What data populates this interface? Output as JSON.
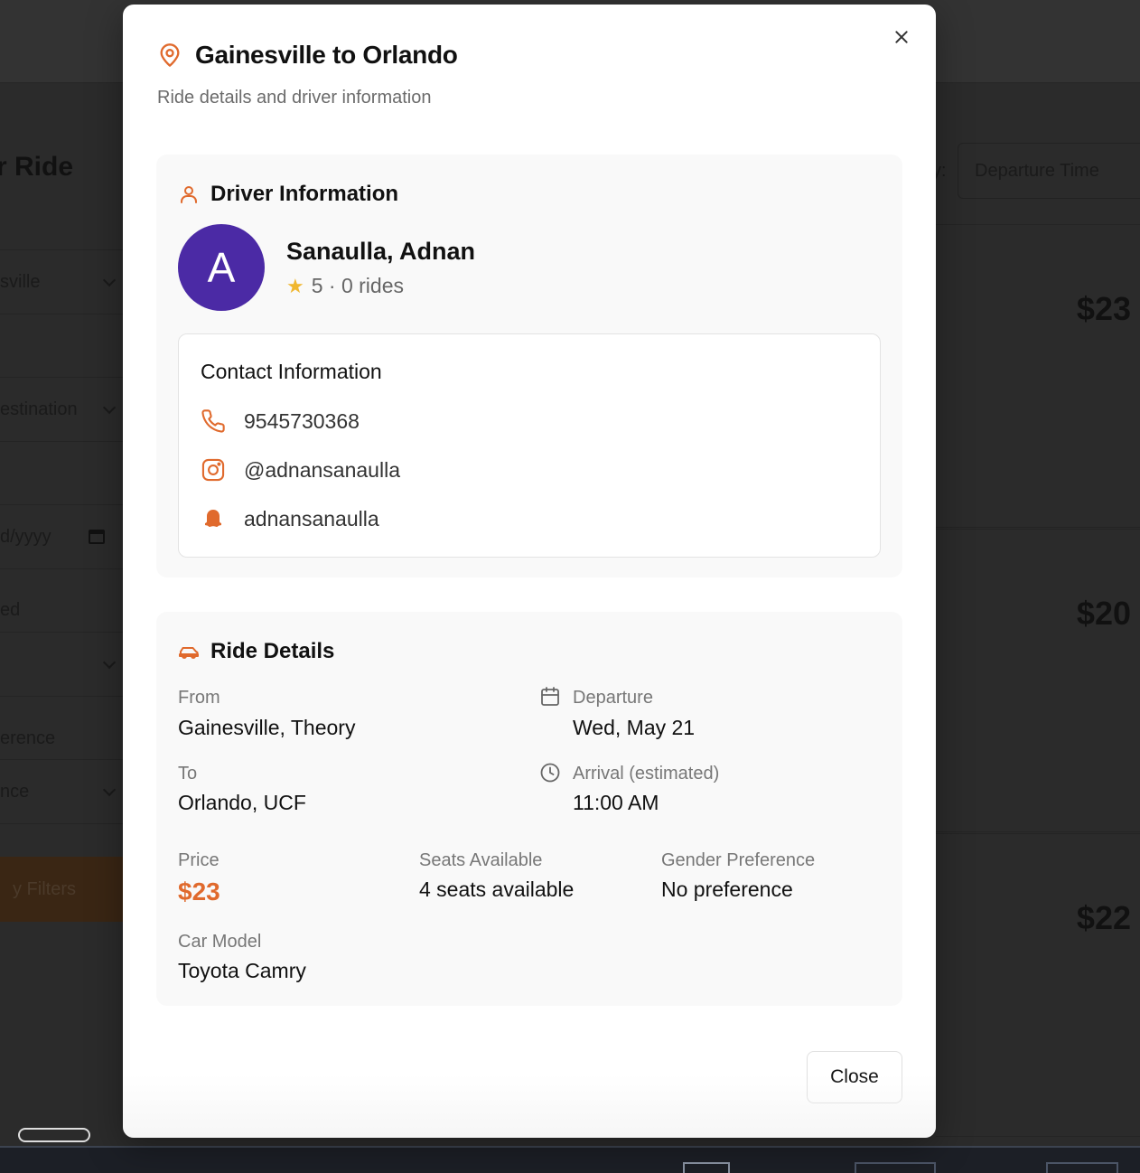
{
  "background": {
    "page_title": "r Ride",
    "fields": [
      "sville",
      "estination",
      "d/yyyy",
      "ed",
      "",
      "erence",
      "nce"
    ],
    "apply_filters": "y Filters",
    "sort_colon": "y:",
    "sort_value": "Departure Time",
    "prices": [
      "$23",
      "$20",
      "$22"
    ]
  },
  "modal": {
    "title": "Gainesville to Orlando",
    "subtitle": "Ride details and driver information",
    "driver_section": {
      "heading": "Driver Information",
      "avatar_letter": "A",
      "name": "Sanaulla, Adnan",
      "rating": "5 · 0 rides",
      "contact": {
        "heading": "Contact Information",
        "phone": "9545730368",
        "instagram": "@adnansanaulla",
        "snapchat": "adnansanaulla"
      }
    },
    "ride_section": {
      "heading": "Ride Details",
      "from_label": "From",
      "from_value": "Gainesville, Theory",
      "to_label": "To",
      "to_value": "Orlando, UCF",
      "departure_label": "Departure",
      "departure_value": "Wed, May 21",
      "arrival_label": "Arrival (estimated)",
      "arrival_value": "11:00 AM",
      "price_label": "Price",
      "price_value": "$23",
      "seats_label": "Seats Available",
      "seats_value": "4 seats available",
      "gender_label": "Gender Preference",
      "gender_value": "No preference",
      "car_label": "Car Model",
      "car_value": "Toyota Camry"
    },
    "close_label": "Close"
  },
  "colors": {
    "accent": "#e06a2d",
    "avatar_bg": "#4b2aa5",
    "star": "#f0b72f"
  },
  "icons": {
    "title": "map-pin-icon",
    "driver": "user-icon",
    "phone": "phone-icon",
    "instagram": "instagram-icon",
    "snapchat": "snapchat-icon",
    "ride": "car-icon",
    "departure": "calendar-icon",
    "arrival": "clock-icon",
    "close": "close-icon"
  }
}
